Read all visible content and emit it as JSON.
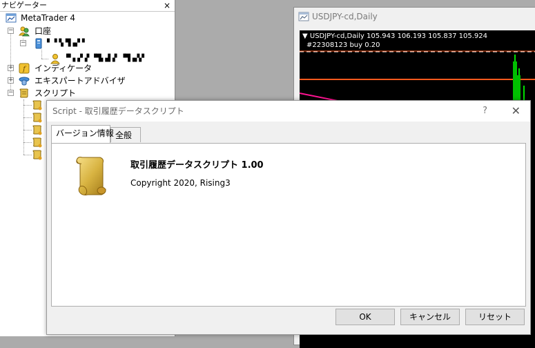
{
  "navigator": {
    "title": "ナビゲーター",
    "close_glyph": "×",
    "root": "MetaTrader 4",
    "accounts": "口座",
    "account_name": "▘▝▝▖▜▗▞▝",
    "account_detail": "▝▘▖▞▗▘▝▜▖▟▗▘ ▝▜▗▞▞",
    "indicators": "インディケータ",
    "experts": "エキスパートアドバイザ",
    "scripts": "スクリプト"
  },
  "chart_window": {
    "title": "USDJPY-cd,Daily",
    "info": "▼ USDJPY-cd,Daily  105.943 106.193 105.837 105.924",
    "trade_label": "#22308123 buy 0.20"
  },
  "dialog": {
    "title": "Script - 取引履歴データスクリプト",
    "help_glyph": "?",
    "close_glyph": "✕",
    "tabs": [
      "バージョン情報",
      "全般"
    ],
    "script_title": "取引履歴データスクリプト 1.00",
    "copyright": "Copyright 2020, Rising3",
    "buttons": {
      "ok": "OK",
      "cancel": "キャンセル",
      "reset": "リセット"
    }
  },
  "colors": {
    "chart_bg": "#000000",
    "chart_level_line": "#ff5a1e",
    "chart_ma_line": "#ff1493",
    "chart_candle": "#00e000",
    "script_icon": "#d8b341"
  }
}
